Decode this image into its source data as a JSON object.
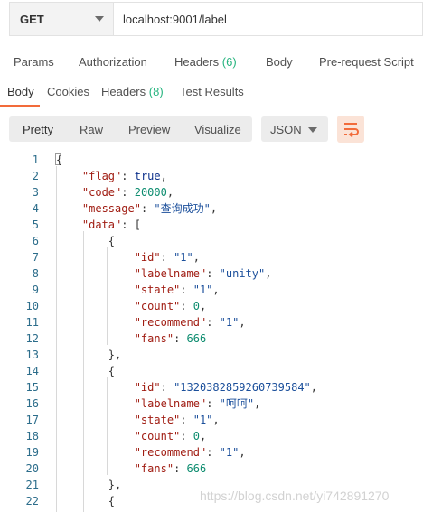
{
  "request": {
    "method": "GET",
    "url": "localhost:9001/label"
  },
  "request_tabs": [
    {
      "label": "Params"
    },
    {
      "label": "Authorization"
    },
    {
      "label": "Headers",
      "count": "(6)"
    },
    {
      "label": "Body"
    },
    {
      "label": "Pre-request Script"
    }
  ],
  "response_tabs": [
    {
      "label": "Body",
      "active": true
    },
    {
      "label": "Cookies"
    },
    {
      "label": "Headers",
      "count": "(8)"
    },
    {
      "label": "Test Results"
    }
  ],
  "view_modes": [
    "Pretty",
    "Raw",
    "Preview",
    "Visualize"
  ],
  "active_view": "Pretty",
  "format": "JSON",
  "colors": {
    "accent": "#f26b3a",
    "count_green": "#26b47f",
    "json_key": "#a01c12",
    "json_string": "#1b4f9b",
    "json_number": "#0e8d70",
    "json_boolean": "#0b2f8a"
  },
  "code_lines": [
    {
      "n": "1",
      "parts": [
        {
          "t": "{",
          "c": "p"
        }
      ]
    },
    {
      "n": "2",
      "parts": [
        {
          "t": "    "
        },
        {
          "t": "\"flag\"",
          "c": "k"
        },
        {
          "t": ": ",
          "c": "p"
        },
        {
          "t": "true",
          "c": "b"
        },
        {
          "t": ",",
          "c": "p"
        }
      ]
    },
    {
      "n": "3",
      "parts": [
        {
          "t": "    "
        },
        {
          "t": "\"code\"",
          "c": "k"
        },
        {
          "t": ": ",
          "c": "p"
        },
        {
          "t": "20000",
          "c": "n"
        },
        {
          "t": ",",
          "c": "p"
        }
      ]
    },
    {
      "n": "4",
      "parts": [
        {
          "t": "    "
        },
        {
          "t": "\"message\"",
          "c": "k"
        },
        {
          "t": ": ",
          "c": "p"
        },
        {
          "t": "\"查询成功\"",
          "c": "s"
        },
        {
          "t": ",",
          "c": "p"
        }
      ]
    },
    {
      "n": "5",
      "parts": [
        {
          "t": "    "
        },
        {
          "t": "\"data\"",
          "c": "k"
        },
        {
          "t": ": [",
          "c": "p"
        }
      ]
    },
    {
      "n": "6",
      "parts": [
        {
          "t": "        "
        },
        {
          "t": "{",
          "c": "p"
        }
      ]
    },
    {
      "n": "7",
      "parts": [
        {
          "t": "            "
        },
        {
          "t": "\"id\"",
          "c": "k"
        },
        {
          "t": ": ",
          "c": "p"
        },
        {
          "t": "\"1\"",
          "c": "s"
        },
        {
          "t": ",",
          "c": "p"
        }
      ]
    },
    {
      "n": "8",
      "parts": [
        {
          "t": "            "
        },
        {
          "t": "\"labelname\"",
          "c": "k"
        },
        {
          "t": ": ",
          "c": "p"
        },
        {
          "t": "\"unity\"",
          "c": "s"
        },
        {
          "t": ",",
          "c": "p"
        }
      ]
    },
    {
      "n": "9",
      "parts": [
        {
          "t": "            "
        },
        {
          "t": "\"state\"",
          "c": "k"
        },
        {
          "t": ": ",
          "c": "p"
        },
        {
          "t": "\"1\"",
          "c": "s"
        },
        {
          "t": ",",
          "c": "p"
        }
      ]
    },
    {
      "n": "10",
      "parts": [
        {
          "t": "            "
        },
        {
          "t": "\"count\"",
          "c": "k"
        },
        {
          "t": ": ",
          "c": "p"
        },
        {
          "t": "0",
          "c": "n"
        },
        {
          "t": ",",
          "c": "p"
        }
      ]
    },
    {
      "n": "11",
      "parts": [
        {
          "t": "            "
        },
        {
          "t": "\"recommend\"",
          "c": "k"
        },
        {
          "t": ": ",
          "c": "p"
        },
        {
          "t": "\"1\"",
          "c": "s"
        },
        {
          "t": ",",
          "c": "p"
        }
      ]
    },
    {
      "n": "12",
      "parts": [
        {
          "t": "            "
        },
        {
          "t": "\"fans\"",
          "c": "k"
        },
        {
          "t": ": ",
          "c": "p"
        },
        {
          "t": "666",
          "c": "n"
        }
      ]
    },
    {
      "n": "13",
      "parts": [
        {
          "t": "        "
        },
        {
          "t": "},",
          "c": "p"
        }
      ]
    },
    {
      "n": "14",
      "parts": [
        {
          "t": "        "
        },
        {
          "t": "{",
          "c": "p"
        }
      ]
    },
    {
      "n": "15",
      "parts": [
        {
          "t": "            "
        },
        {
          "t": "\"id\"",
          "c": "k"
        },
        {
          "t": ": ",
          "c": "p"
        },
        {
          "t": "\"1320382859260739584\"",
          "c": "s"
        },
        {
          "t": ",",
          "c": "p"
        }
      ]
    },
    {
      "n": "16",
      "parts": [
        {
          "t": "            "
        },
        {
          "t": "\"labelname\"",
          "c": "k"
        },
        {
          "t": ": ",
          "c": "p"
        },
        {
          "t": "\"呵呵\"",
          "c": "s"
        },
        {
          "t": ",",
          "c": "p"
        }
      ]
    },
    {
      "n": "17",
      "parts": [
        {
          "t": "            "
        },
        {
          "t": "\"state\"",
          "c": "k"
        },
        {
          "t": ": ",
          "c": "p"
        },
        {
          "t": "\"1\"",
          "c": "s"
        },
        {
          "t": ",",
          "c": "p"
        }
      ]
    },
    {
      "n": "18",
      "parts": [
        {
          "t": "            "
        },
        {
          "t": "\"count\"",
          "c": "k"
        },
        {
          "t": ": ",
          "c": "p"
        },
        {
          "t": "0",
          "c": "n"
        },
        {
          "t": ",",
          "c": "p"
        }
      ]
    },
    {
      "n": "19",
      "parts": [
        {
          "t": "            "
        },
        {
          "t": "\"recommend\"",
          "c": "k"
        },
        {
          "t": ": ",
          "c": "p"
        },
        {
          "t": "\"1\"",
          "c": "s"
        },
        {
          "t": ",",
          "c": "p"
        }
      ]
    },
    {
      "n": "20",
      "parts": [
        {
          "t": "            "
        },
        {
          "t": "\"fans\"",
          "c": "k"
        },
        {
          "t": ": ",
          "c": "p"
        },
        {
          "t": "666",
          "c": "n"
        }
      ]
    },
    {
      "n": "21",
      "parts": [
        {
          "t": "        "
        },
        {
          "t": "},",
          "c": "p"
        }
      ]
    },
    {
      "n": "22",
      "parts": [
        {
          "t": "        "
        },
        {
          "t": "{",
          "c": "p"
        }
      ]
    }
  ],
  "watermark": "https://blog.csdn.net/yi742891270"
}
